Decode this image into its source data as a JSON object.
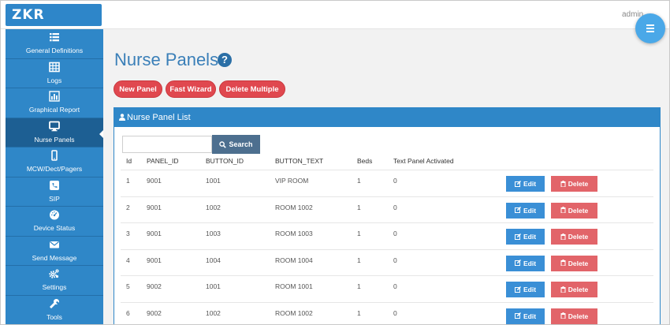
{
  "app": {
    "logo_text": "ZKR",
    "user_label": "admin"
  },
  "sidebar": {
    "items": [
      {
        "label": "General Definitions",
        "icon": "list-icon"
      },
      {
        "label": "Logs",
        "icon": "table-icon"
      },
      {
        "label": "Graphical Report",
        "icon": "bar-chart-icon"
      },
      {
        "label": "Nurse Panels",
        "icon": "monitor-icon",
        "active": true
      },
      {
        "label": "MCW/Dect/Pagers",
        "icon": "mobile-icon"
      },
      {
        "label": "SIP",
        "icon": "phone-icon"
      },
      {
        "label": "Device Status",
        "icon": "dashboard-icon"
      },
      {
        "label": "Send Message",
        "icon": "envelope-icon"
      },
      {
        "label": "Settings",
        "icon": "gears-icon"
      },
      {
        "label": "Tools",
        "icon": "wrench-icon"
      }
    ]
  },
  "page": {
    "title": "Nurse Panels",
    "help": "?",
    "actions": {
      "new_panel": "New Panel",
      "fast_wizard": "Fast Wizard",
      "delete_multiple": "Delete Multiple"
    }
  },
  "panel": {
    "title": "Nurse Panel List",
    "search": {
      "value": "",
      "placeholder": "",
      "button_label": "Search"
    },
    "columns": [
      "Id",
      "PANEL_ID",
      "BUTTON_ID",
      "BUTTON_TEXT",
      "Beds",
      "Text Panel Activated"
    ],
    "rows": [
      [
        "1",
        "9001",
        "1001",
        "VIP ROOM",
        "1",
        "0"
      ],
      [
        "2",
        "9001",
        "1002",
        "ROOM 1002",
        "1",
        "0"
      ],
      [
        "3",
        "9001",
        "1003",
        "ROOM 1003",
        "1",
        "0"
      ],
      [
        "4",
        "9001",
        "1004",
        "ROOM 1004",
        "1",
        "0"
      ],
      [
        "5",
        "9002",
        "1001",
        "ROOM 1001",
        "1",
        "0"
      ],
      [
        "6",
        "9002",
        "1002",
        "ROOM 1002",
        "1",
        "0"
      ]
    ],
    "row_actions": {
      "edit": "Edit",
      "delete": "Delete"
    }
  },
  "colors": {
    "accent": "#2f87c8",
    "sidebar_active": "#1d5f93",
    "danger": "#e0484f",
    "edit": "#3a8fd6",
    "search_button": "#4d6f8f"
  }
}
